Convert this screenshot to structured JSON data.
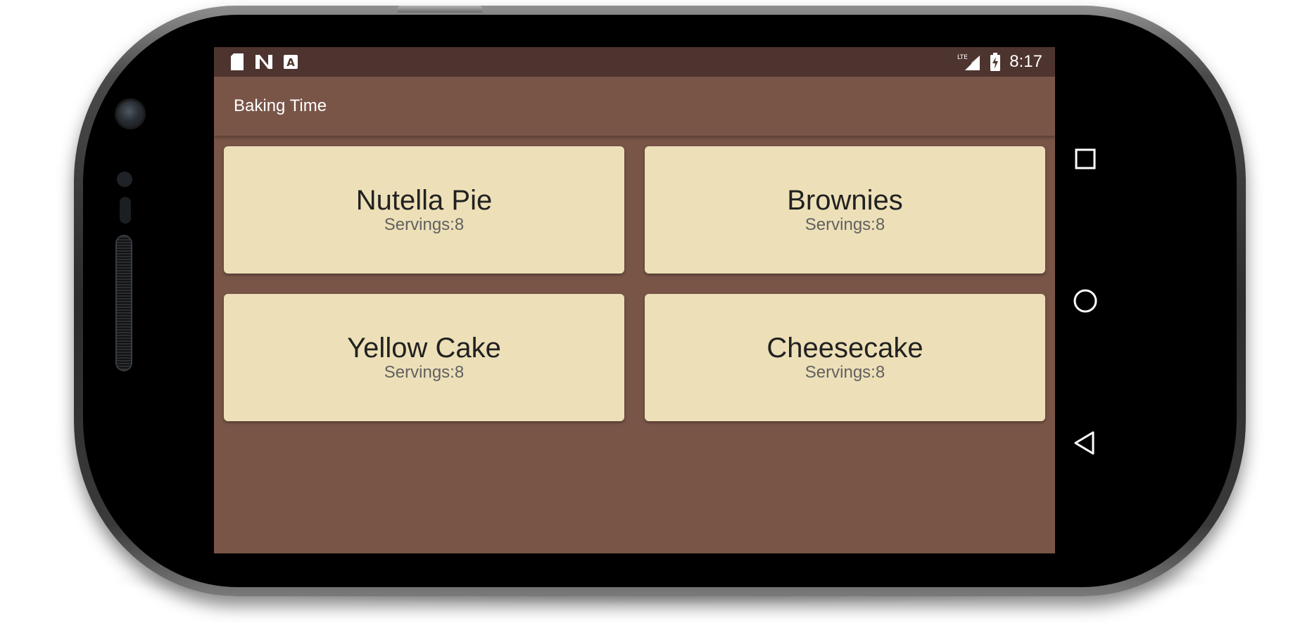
{
  "status_bar": {
    "time": "8:17",
    "left_icons": [
      "sd-card-icon",
      "n-logo-icon",
      "keyboard-a-icon"
    ],
    "right_icons": [
      "lte-signal-icon",
      "battery-charging-icon"
    ],
    "network": "LTE"
  },
  "app_bar": {
    "title": "Baking Time"
  },
  "recipes": [
    {
      "name": "Nutella Pie",
      "servings": "Servings:8"
    },
    {
      "name": "Brownies",
      "servings": "Servings:8"
    },
    {
      "name": "Yellow Cake",
      "servings": "Servings:8"
    },
    {
      "name": "Cheesecake",
      "servings": "Servings:8"
    }
  ],
  "nav_bar": {
    "buttons": [
      "recents-square-icon",
      "home-circle-icon",
      "back-triangle-icon"
    ]
  },
  "colors": {
    "primary": "#795548",
    "primary_dark": "#4e342e",
    "card_background": "#ede0b8"
  }
}
